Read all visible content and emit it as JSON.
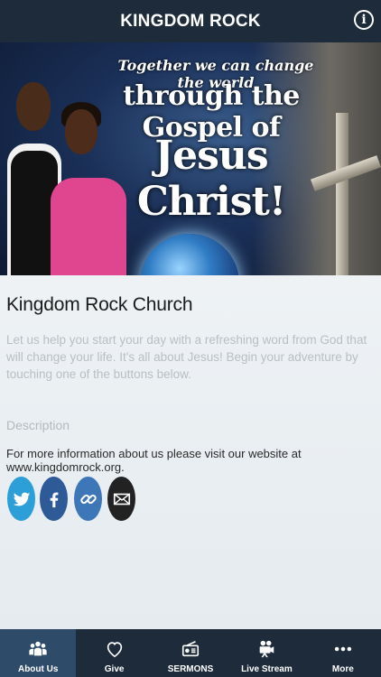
{
  "header": {
    "title": "KINGDOM ROCK",
    "info_icon": "info-icon"
  },
  "banner": {
    "tagline": "Together we can change the world",
    "line2": "through the Gospel of",
    "line3": "Jesus Christ!"
  },
  "main": {
    "title": "Kingdom Rock Church",
    "intro": "Let us help you start your day with a refreshing word from God that will change your life. It's all about Jesus! Begin your adventure by touching one of the buttons below.",
    "description_label": "Description",
    "description_text": "For more information about us please visit our website at www.kingdomrock.org."
  },
  "social": [
    {
      "icon": "twitter-icon",
      "color": "#2c9ed8"
    },
    {
      "icon": "facebook-icon",
      "color": "#2e5a97"
    },
    {
      "icon": "link-icon",
      "color": "#3d77b8"
    },
    {
      "icon": "email-icon",
      "color": "#222222"
    }
  ],
  "tabs": [
    {
      "label": "About Us",
      "icon": "people-icon",
      "active": true
    },
    {
      "label": "Give",
      "icon": "heart-icon",
      "active": false
    },
    {
      "label": "SERMONS",
      "icon": "radio-icon",
      "active": false
    },
    {
      "label": "Live Stream",
      "icon": "camera-icon",
      "active": false
    },
    {
      "label": "More",
      "icon": "more-icon",
      "active": false
    }
  ],
  "colors": {
    "bar": "#1d2b3a",
    "active_tab": "#2f4b6a",
    "background": "#e8eef2"
  }
}
